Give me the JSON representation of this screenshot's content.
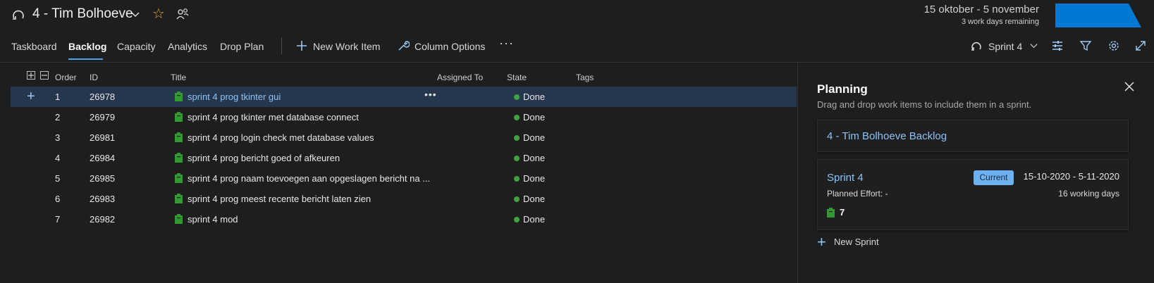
{
  "header": {
    "team_name": "4 - Tim Bolhoeve",
    "icons": [
      "sprint-cycle-icon",
      "chevron-down-icon",
      "favorite-star-icon",
      "team-members-icon"
    ],
    "sprint_dates": "15 oktober - 5 november",
    "work_days_remaining": "3 work days remaining",
    "accent_color": "#0078d4",
    "star_color": "#e0a836"
  },
  "toolbar": {
    "tabs": [
      {
        "label": "Taskboard",
        "selected": false
      },
      {
        "label": "Backlog",
        "selected": true
      },
      {
        "label": "Capacity",
        "selected": false
      },
      {
        "label": "Analytics",
        "selected": false
      },
      {
        "label": "Drop Plan",
        "selected": false
      }
    ],
    "new_work_item_label": "New Work Item",
    "column_options_label": "Column Options",
    "more_label": "···",
    "sprint_picker_label": "Sprint 4",
    "icons": [
      "plus-icon",
      "wrench-icon",
      "more-icon",
      "sprint-cycle-icon",
      "settings-sliders-icon",
      "filter-icon",
      "gear-icon",
      "fullscreen-icon"
    ]
  },
  "grid": {
    "columns": {
      "order": "Order",
      "id": "ID",
      "title": "Title",
      "assigned_to": "Assigned To",
      "state": "State",
      "tags": "Tags"
    },
    "rows": [
      {
        "order": "1",
        "id": "26978",
        "title": "sprint 4 prog tkinter gui",
        "state": "Done",
        "selected": true
      },
      {
        "order": "2",
        "id": "26979",
        "title": "sprint 4 prog tkinter met database connect",
        "state": "Done"
      },
      {
        "order": "3",
        "id": "26981",
        "title": "sprint 4 prog login check met database values",
        "state": "Done"
      },
      {
        "order": "4",
        "id": "26984",
        "title": "sprint 4 prog bericht goed of afkeuren",
        "state": "Done"
      },
      {
        "order": "5",
        "id": "26985",
        "title": "sprint 4 prog naam toevoegen aan opgeslagen bericht na ...",
        "state": "Done"
      },
      {
        "order": "6",
        "id": "26983",
        "title": "sprint 4 prog meest recente bericht laten zien",
        "state": "Done"
      },
      {
        "order": "7",
        "id": "26982",
        "title": "sprint 4 mod",
        "state": "Done"
      }
    ],
    "done_color": "#3fa33f",
    "workitem_icon_color": "#339933"
  },
  "planning": {
    "title": "Planning",
    "subtitle": "Drag and drop work items to include them in a sprint.",
    "backlog_card": "4 - Tim Bolhoeve Backlog",
    "sprint_card": {
      "name": "Sprint 4",
      "badge": "Current",
      "dates": "15-10-2020 - 5-11-2020",
      "planned_effort": "Planned Effort: -",
      "working_days": "16 working days",
      "item_count": "7"
    },
    "new_sprint_label": "New Sprint"
  }
}
